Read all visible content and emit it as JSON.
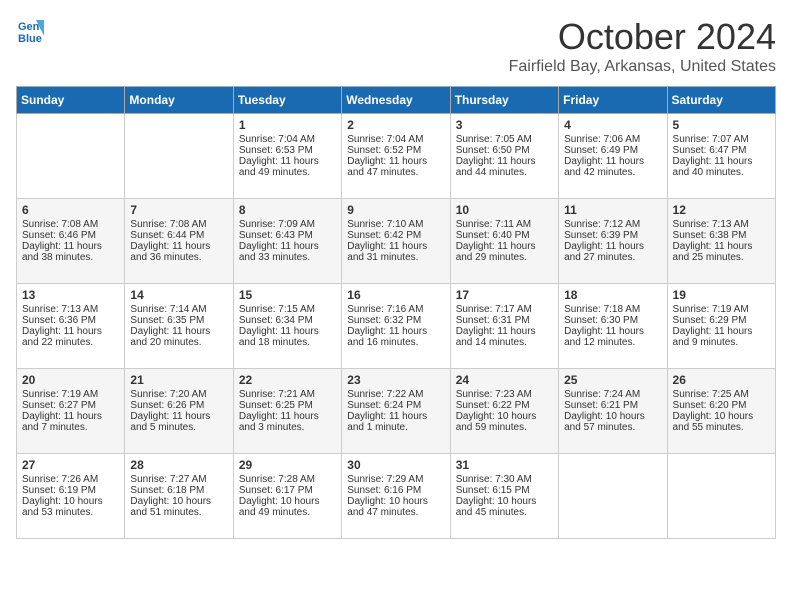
{
  "logo": {
    "line1": "General",
    "line2": "Blue"
  },
  "title": "October 2024",
  "location": "Fairfield Bay, Arkansas, United States",
  "days_of_week": [
    "Sunday",
    "Monday",
    "Tuesday",
    "Wednesday",
    "Thursday",
    "Friday",
    "Saturday"
  ],
  "weeks": [
    [
      {
        "day": "",
        "sunrise": "",
        "sunset": "",
        "daylight": ""
      },
      {
        "day": "",
        "sunrise": "",
        "sunset": "",
        "daylight": ""
      },
      {
        "day": "1",
        "sunrise": "Sunrise: 7:04 AM",
        "sunset": "Sunset: 6:53 PM",
        "daylight": "Daylight: 11 hours and 49 minutes."
      },
      {
        "day": "2",
        "sunrise": "Sunrise: 7:04 AM",
        "sunset": "Sunset: 6:52 PM",
        "daylight": "Daylight: 11 hours and 47 minutes."
      },
      {
        "day": "3",
        "sunrise": "Sunrise: 7:05 AM",
        "sunset": "Sunset: 6:50 PM",
        "daylight": "Daylight: 11 hours and 44 minutes."
      },
      {
        "day": "4",
        "sunrise": "Sunrise: 7:06 AM",
        "sunset": "Sunset: 6:49 PM",
        "daylight": "Daylight: 11 hours and 42 minutes."
      },
      {
        "day": "5",
        "sunrise": "Sunrise: 7:07 AM",
        "sunset": "Sunset: 6:47 PM",
        "daylight": "Daylight: 11 hours and 40 minutes."
      }
    ],
    [
      {
        "day": "6",
        "sunrise": "Sunrise: 7:08 AM",
        "sunset": "Sunset: 6:46 PM",
        "daylight": "Daylight: 11 hours and 38 minutes."
      },
      {
        "day": "7",
        "sunrise": "Sunrise: 7:08 AM",
        "sunset": "Sunset: 6:44 PM",
        "daylight": "Daylight: 11 hours and 36 minutes."
      },
      {
        "day": "8",
        "sunrise": "Sunrise: 7:09 AM",
        "sunset": "Sunset: 6:43 PM",
        "daylight": "Daylight: 11 hours and 33 minutes."
      },
      {
        "day": "9",
        "sunrise": "Sunrise: 7:10 AM",
        "sunset": "Sunset: 6:42 PM",
        "daylight": "Daylight: 11 hours and 31 minutes."
      },
      {
        "day": "10",
        "sunrise": "Sunrise: 7:11 AM",
        "sunset": "Sunset: 6:40 PM",
        "daylight": "Daylight: 11 hours and 29 minutes."
      },
      {
        "day": "11",
        "sunrise": "Sunrise: 7:12 AM",
        "sunset": "Sunset: 6:39 PM",
        "daylight": "Daylight: 11 hours and 27 minutes."
      },
      {
        "day": "12",
        "sunrise": "Sunrise: 7:13 AM",
        "sunset": "Sunset: 6:38 PM",
        "daylight": "Daylight: 11 hours and 25 minutes."
      }
    ],
    [
      {
        "day": "13",
        "sunrise": "Sunrise: 7:13 AM",
        "sunset": "Sunset: 6:36 PM",
        "daylight": "Daylight: 11 hours and 22 minutes."
      },
      {
        "day": "14",
        "sunrise": "Sunrise: 7:14 AM",
        "sunset": "Sunset: 6:35 PM",
        "daylight": "Daylight: 11 hours and 20 minutes."
      },
      {
        "day": "15",
        "sunrise": "Sunrise: 7:15 AM",
        "sunset": "Sunset: 6:34 PM",
        "daylight": "Daylight: 11 hours and 18 minutes."
      },
      {
        "day": "16",
        "sunrise": "Sunrise: 7:16 AM",
        "sunset": "Sunset: 6:32 PM",
        "daylight": "Daylight: 11 hours and 16 minutes."
      },
      {
        "day": "17",
        "sunrise": "Sunrise: 7:17 AM",
        "sunset": "Sunset: 6:31 PM",
        "daylight": "Daylight: 11 hours and 14 minutes."
      },
      {
        "day": "18",
        "sunrise": "Sunrise: 7:18 AM",
        "sunset": "Sunset: 6:30 PM",
        "daylight": "Daylight: 11 hours and 12 minutes."
      },
      {
        "day": "19",
        "sunrise": "Sunrise: 7:19 AM",
        "sunset": "Sunset: 6:29 PM",
        "daylight": "Daylight: 11 hours and 9 minutes."
      }
    ],
    [
      {
        "day": "20",
        "sunrise": "Sunrise: 7:19 AM",
        "sunset": "Sunset: 6:27 PM",
        "daylight": "Daylight: 11 hours and 7 minutes."
      },
      {
        "day": "21",
        "sunrise": "Sunrise: 7:20 AM",
        "sunset": "Sunset: 6:26 PM",
        "daylight": "Daylight: 11 hours and 5 minutes."
      },
      {
        "day": "22",
        "sunrise": "Sunrise: 7:21 AM",
        "sunset": "Sunset: 6:25 PM",
        "daylight": "Daylight: 11 hours and 3 minutes."
      },
      {
        "day": "23",
        "sunrise": "Sunrise: 7:22 AM",
        "sunset": "Sunset: 6:24 PM",
        "daylight": "Daylight: 11 hours and 1 minute."
      },
      {
        "day": "24",
        "sunrise": "Sunrise: 7:23 AM",
        "sunset": "Sunset: 6:22 PM",
        "daylight": "Daylight: 10 hours and 59 minutes."
      },
      {
        "day": "25",
        "sunrise": "Sunrise: 7:24 AM",
        "sunset": "Sunset: 6:21 PM",
        "daylight": "Daylight: 10 hours and 57 minutes."
      },
      {
        "day": "26",
        "sunrise": "Sunrise: 7:25 AM",
        "sunset": "Sunset: 6:20 PM",
        "daylight": "Daylight: 10 hours and 55 minutes."
      }
    ],
    [
      {
        "day": "27",
        "sunrise": "Sunrise: 7:26 AM",
        "sunset": "Sunset: 6:19 PM",
        "daylight": "Daylight: 10 hours and 53 minutes."
      },
      {
        "day": "28",
        "sunrise": "Sunrise: 7:27 AM",
        "sunset": "Sunset: 6:18 PM",
        "daylight": "Daylight: 10 hours and 51 minutes."
      },
      {
        "day": "29",
        "sunrise": "Sunrise: 7:28 AM",
        "sunset": "Sunset: 6:17 PM",
        "daylight": "Daylight: 10 hours and 49 minutes."
      },
      {
        "day": "30",
        "sunrise": "Sunrise: 7:29 AM",
        "sunset": "Sunset: 6:16 PM",
        "daylight": "Daylight: 10 hours and 47 minutes."
      },
      {
        "day": "31",
        "sunrise": "Sunrise: 7:30 AM",
        "sunset": "Sunset: 6:15 PM",
        "daylight": "Daylight: 10 hours and 45 minutes."
      },
      {
        "day": "",
        "sunrise": "",
        "sunset": "",
        "daylight": ""
      },
      {
        "day": "",
        "sunrise": "",
        "sunset": "",
        "daylight": ""
      }
    ]
  ]
}
